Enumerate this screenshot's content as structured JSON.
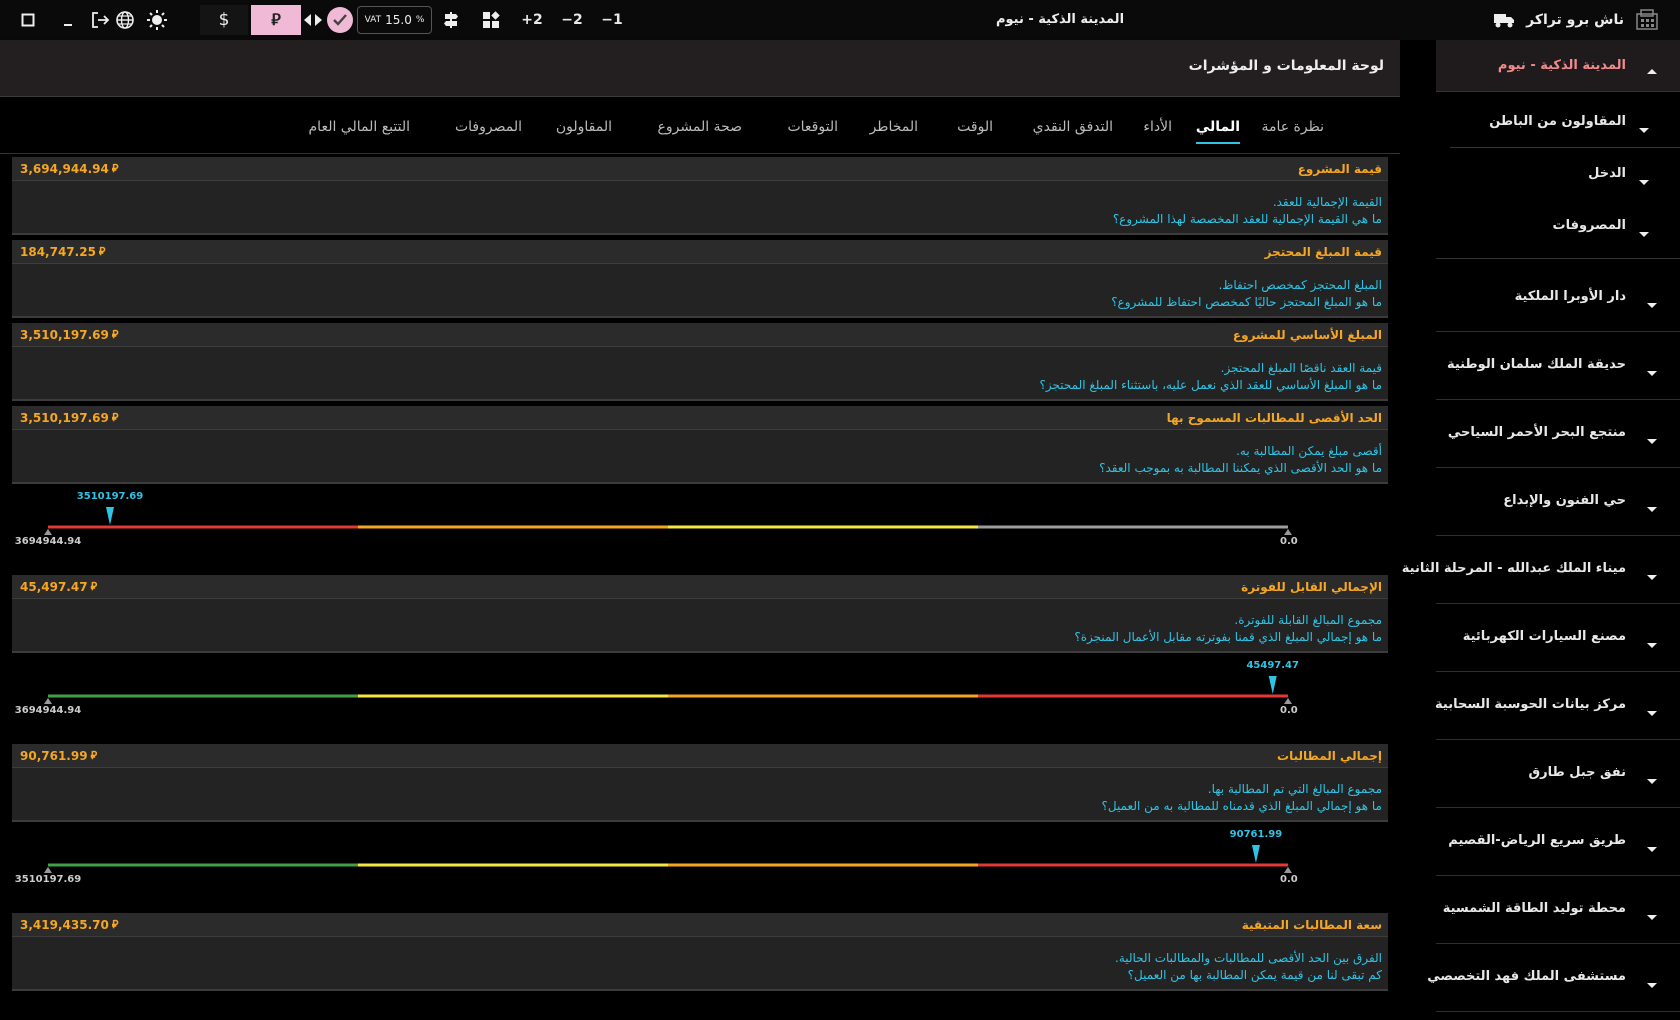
{
  "topbar": {
    "project_title": "المدينة الذكية - نيوم",
    "brand_name": "ناش برو تراكر",
    "vat_label": "VAT",
    "vat_value": "15.0",
    "vat_unit": "%",
    "currency_dollar": "$",
    "currency_riyal": "⃁",
    "zoom_buttons": [
      "+2",
      "−2",
      "−1"
    ]
  },
  "sidebar": {
    "active_project": "المدينة الذكية - نيوم",
    "sub_items": [
      {
        "label": "المقاولون من الباطن"
      },
      {
        "label": "الدخل"
      },
      {
        "label": "المصروفات"
      }
    ],
    "projects": [
      {
        "label": "دار الأوبرا الملكية"
      },
      {
        "label": "حديقة الملك سلمان الوطنية"
      },
      {
        "label": "منتجع البحر الأحمر السياحي"
      },
      {
        "label": "حي الفنون والإبداع"
      },
      {
        "label": "ميناء الملك عبدالله - المرحلة الثانية"
      },
      {
        "label": "مصنع السيارات الكهربائية"
      },
      {
        "label": "مركز بيانات الحوسبة السحابية"
      },
      {
        "label": "نفق جبل طارق"
      },
      {
        "label": "طريق سريع الرياض-القصيم"
      },
      {
        "label": "محطة توليد الطاقة الشمسية"
      },
      {
        "label": "مستشفى الملك فهد التخصصي"
      }
    ]
  },
  "main": {
    "dashboard_title": "لوحة المعلومات و المؤشرات",
    "tabs": [
      {
        "label": "نظرة عامة",
        "active": false
      },
      {
        "label": "المالي",
        "active": true
      },
      {
        "label": "الأداء",
        "active": false
      },
      {
        "label": "التدفق النقدي",
        "active": false
      },
      {
        "label": "الوقت",
        "active": false
      },
      {
        "label": "المخاطر",
        "active": false
      },
      {
        "label": "التوقعات",
        "active": false
      },
      {
        "label": "صحة المشروع",
        "active": false
      },
      {
        "label": "المقاولون",
        "active": false
      },
      {
        "label": "المصروفات",
        "active": false
      },
      {
        "label": "التتبع المالي العام",
        "active": false
      }
    ],
    "currency_symbol": "⃁",
    "cards": [
      {
        "title": "قيمة المشروع",
        "value": "3,694,944.94",
        "desc": "القيمة الإجمالية للعقد.",
        "question": "ما هي القيمة الإجمالية للعقد المخصصة لهذا المشروع؟"
      },
      {
        "title": "قيمة المبلغ المحتجز",
        "value": "184,747.25",
        "desc": "المبلغ المحتجز كمخصص احتفاظ.",
        "question": "ما هو المبلغ المحتجز حاليًا كمخصص احتفاظ للمشروع؟"
      },
      {
        "title": "المبلغ الأساسي للمشروع",
        "value": "3,510,197.69",
        "desc": "قيمة العقد ناقصًا المبلغ المحتجز.",
        "question": "ما هو المبلغ الأساسي للعقد الذي نعمل عليه، باستثناء المبلغ المحتجز؟"
      },
      {
        "title": "الحد الأقصى للمطالبات المسموح بها",
        "value": "3,510,197.69",
        "desc": "أقصى مبلغ يمكن المطالبة به.",
        "question": "ما هو الحد الأقصى الذي يمكننا المطالبة به بموجب العقد؟"
      },
      {
        "title": "الإجمالي القابل للفوترة",
        "value": "45,497.47",
        "desc": "مجموع المبالغ القابلة للفوترة.",
        "question": "ما هو إجمالي المبلغ الذي قمنا بفوترته مقابل الأعمال المنجزة؟"
      },
      {
        "title": "إجمالي المطالبات",
        "value": "90,761.99",
        "desc": "مجموع المبالغ التي تم المطالبة بها.",
        "question": "ما هو إجمالي المبلغ الذي قدمناه للمطالبة به من العميل؟"
      },
      {
        "title": "سعة المطالبات المتبقية",
        "value": "3,419,435.70",
        "desc": "الفرق بين الحد الأقصى للمطالبات والمطالبات الحالية.",
        "question": "كم تبقى لنا من قيمة يمكن المطالبة بها من العميل؟"
      }
    ],
    "gauges": [
      {
        "marker_label": "3510197.69",
        "marker_value": 3510197.69,
        "min_label": "3694944.94",
        "min": 3694944.94,
        "max_label": "0.0",
        "max": 0,
        "colors": [
          "#e53935",
          "#f5a623",
          "#f5e642",
          "#9e9e9e"
        ]
      },
      {
        "marker_label": "45497.47",
        "marker_value": 45497.47,
        "min_label": "3694944.94",
        "min": 3694944.94,
        "max_label": "0.0",
        "max": 0,
        "colors": [
          "#43a047",
          "#f5e642",
          "#f5a623",
          "#e53935"
        ]
      },
      {
        "marker_label": "90761.99",
        "marker_value": 90761.99,
        "min_label": "3510197.69",
        "min": 3510197.69,
        "max_label": "0.0",
        "max": 0,
        "colors": [
          "#43a047",
          "#f5e642",
          "#f5a623",
          "#e53935"
        ]
      }
    ]
  }
}
